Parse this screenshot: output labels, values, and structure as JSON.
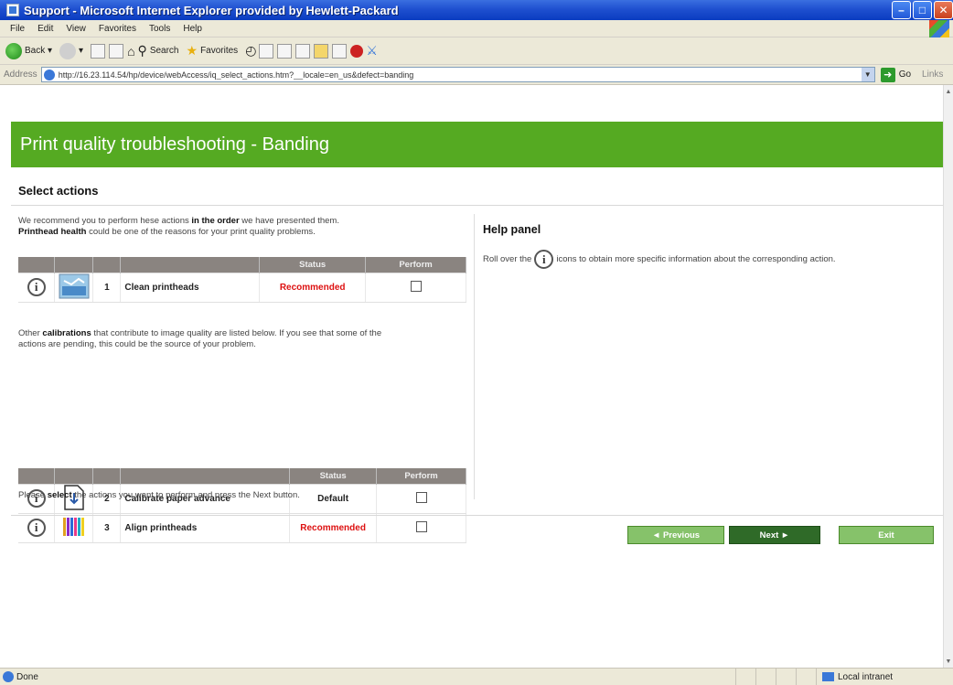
{
  "window": {
    "title": "Support - Microsoft Internet Explorer provided by Hewlett-Packard"
  },
  "menu": [
    "File",
    "Edit",
    "View",
    "Favorites",
    "Tools",
    "Help"
  ],
  "toolbar": {
    "back": "Back",
    "search": "Search",
    "favorites": "Favorites"
  },
  "address": {
    "label": "Address",
    "url": "http://16.23.114.54/hp/device/webAccess/iq_select_actions.htm?__locale=en_us&defect=banding",
    "go": "Go",
    "links": "Links"
  },
  "page": {
    "banner": "Print quality troubleshooting - Banding",
    "section_title": "Select actions",
    "intro": {
      "p1": "We recommend you to perform hese actions ",
      "p1_bold": "in the order",
      "p1_end": " we have presented them.",
      "p2_bold": "Printhead health",
      "p2_end": " could be one of the reasons for your print quality problems."
    },
    "table_headers": {
      "status": "Status",
      "perform": "Perform"
    },
    "table1": [
      {
        "num": "1",
        "action": "Clean printheads",
        "status": "Recommended",
        "icon": "printhead-clean-icon"
      }
    ],
    "other": {
      "p1": "Other ",
      "p1_bold": "calibrations",
      "p1_end": " that contribute to image quality are listed below. If you see that some of the",
      "p2": "actions are pending, this could be the source of your problem."
    },
    "table2": [
      {
        "num": "2",
        "action": "Calibrate paper advance",
        "status": "Default",
        "icon": "paper-advance-icon"
      },
      {
        "num": "3",
        "action": "Align printheads",
        "status": "Recommended",
        "icon": "align-printheads-icon"
      }
    ],
    "bottom": {
      "p1": "Please ",
      "p1_bold": "select",
      "p1_end": " the actions you want to perform and press the Next button."
    },
    "help": {
      "title": "Help panel",
      "pre": "Roll over the",
      "post": "icons to obtain more specific information about the corresponding action."
    },
    "buttons": {
      "previous": "◄ Previous",
      "next": "Next ►",
      "exit": "Exit"
    },
    "info_glyph": "i"
  },
  "status_bar": {
    "done": "Done",
    "zone": "Local intranet"
  },
  "colors": {
    "banner": "#55aa22",
    "recommended": "#dd1111",
    "next_button": "#2f6a28"
  }
}
